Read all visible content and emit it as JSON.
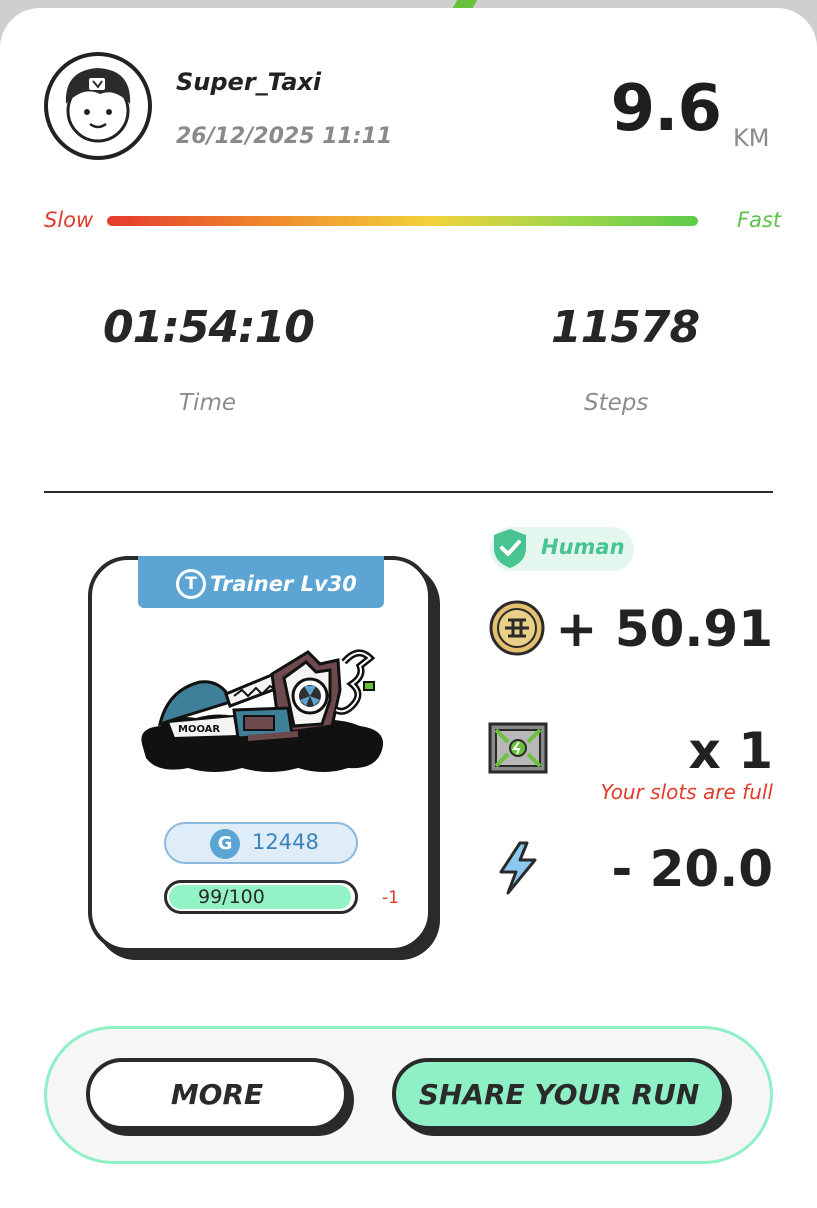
{
  "user": {
    "name": "Super_Taxi",
    "datetime": "26/12/2025 11:11",
    "avatar": "avatar-icon"
  },
  "run": {
    "distance": "9.6",
    "distance_unit": "KM",
    "time": "01:54:10",
    "time_label": "Time",
    "steps": "11578",
    "steps_label": "Steps"
  },
  "speed": {
    "slow_label": "Slow",
    "fast_label": "Fast",
    "gradient": [
      "#e53a2d",
      "#f2d33a",
      "#5fcb4a"
    ]
  },
  "trainer": {
    "title": "Trainer Lv30",
    "badge_icon": "T",
    "gems_icon": "G",
    "gems": "12448",
    "durability": "99/100",
    "durability_fraction": 0.99,
    "durability_change": "-1",
    "brand": "MOOAR"
  },
  "verification": {
    "label": "Human",
    "icon": "shield-check-icon"
  },
  "rewards": {
    "coin": {
      "icon": "coin-icon",
      "value": "+ 50.91"
    },
    "box": {
      "icon": "mystery-box-icon",
      "value": "x 1",
      "note": "Your slots are full"
    },
    "energy": {
      "icon": "lightning-icon",
      "value": "- 20.0"
    }
  },
  "actions": {
    "more_label": "MORE",
    "share_label": "SHARE YOUR RUN"
  },
  "colors": {
    "accent_green": "#8ef0c4",
    "trainer_blue": "#5ba4d3",
    "negative_red": "#e23b2c"
  }
}
